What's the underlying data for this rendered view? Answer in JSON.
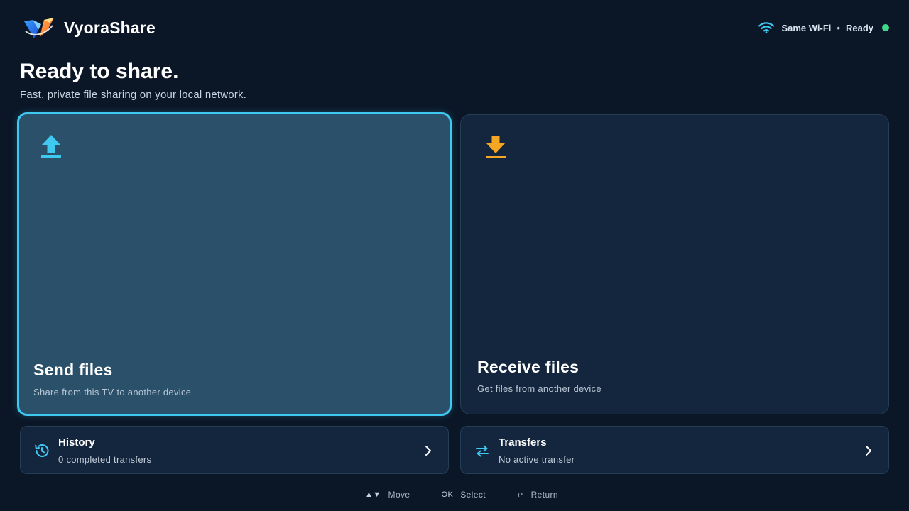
{
  "header": {
    "app_name": "VyoraShare",
    "network": "Same Wi-Fi",
    "separator": "•",
    "status": "Ready"
  },
  "hero": {
    "title": "Ready to share.",
    "subtitle": "Fast, private file sharing on your local network."
  },
  "cards": {
    "send": {
      "title": "Send files",
      "subtitle": "Share from this TV to another device",
      "icon": "upload-icon"
    },
    "receive": {
      "title": "Receive files",
      "subtitle": "Get files from another device",
      "icon": "download-icon"
    }
  },
  "tiles": {
    "history": {
      "title": "History",
      "subtitle": "0 completed transfers",
      "icon": "history-icon"
    },
    "transfers": {
      "title": "Transfers",
      "subtitle": "No active transfer",
      "icon": "swap-arrows-icon"
    }
  },
  "footer": {
    "move_key": "▲▼",
    "move_label": "Move",
    "select_key": "OK",
    "select_label": "Select",
    "return_key": "↵",
    "return_label": "Return"
  },
  "colors": {
    "background": "#0b1727",
    "accent": "#3fc8f0",
    "receive_accent": "#f5a623",
    "ready": "#3fd98a",
    "card_focused": "#2a506a",
    "card": "#14263d"
  }
}
